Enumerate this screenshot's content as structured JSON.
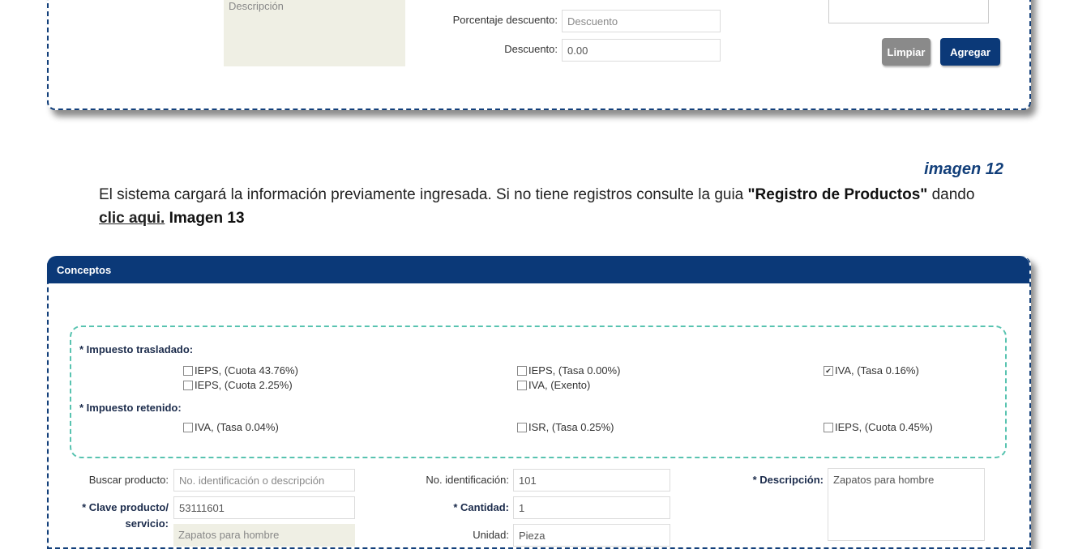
{
  "top_form": {
    "descripcion_placeholder": "Descripción",
    "porcentaje_label": "Porcentaje descuento:",
    "porcentaje_placeholder": "Descuento",
    "descuento_label": "Descuento:",
    "descuento_value": "0.00",
    "limpiar_label": "Limpiar",
    "agregar_label": "Agregar"
  },
  "caption": "imagen 12",
  "paragraph": {
    "text1": "El sistema cargará la información previamente ingresada. Si no tiene registros consulte la guia ",
    "guide": "\"Registro de Productos\"",
    "text2": " dando",
    "link": "clic aqui.",
    "image_ref": " Imagen 13"
  },
  "concepts": {
    "title": "Conceptos",
    "trasladado_label": "* Impuesto trasladado:",
    "retenido_label": "* Impuesto retenido:",
    "taxes": {
      "t1": "IEPS, (Cuota 43.76%)",
      "t2": "IEPS, (Cuota 2.25%)",
      "t3": "IEPS, (Tasa 0.00%)",
      "t4": "IVA, (Exento)",
      "t5": "IVA, (Tasa 0.16%)",
      "r1": "IVA, (Tasa 0.04%)",
      "r2": "ISR, (Tasa 0.25%)",
      "r3": "IEPS, (Cuota 0.45%)"
    },
    "t5_checked": true,
    "buscar_label": "Buscar producto:",
    "buscar_placeholder": "No. identificación o descripción",
    "clave_label": "* Clave producto/",
    "clave_label2": "servicio:",
    "clave_value": "53111601",
    "clave_desc": "Zapatos para hombre",
    "noid_label": "No. identificación:",
    "noid_value": "101",
    "cantidad_label": "* Cantidad:",
    "cantidad_value": "1",
    "unidad_label": "Unidad:",
    "unidad_value": "Pieza",
    "descripcion_label": "* Descripción:",
    "descripcion_value": "Zapatos para hombre"
  }
}
